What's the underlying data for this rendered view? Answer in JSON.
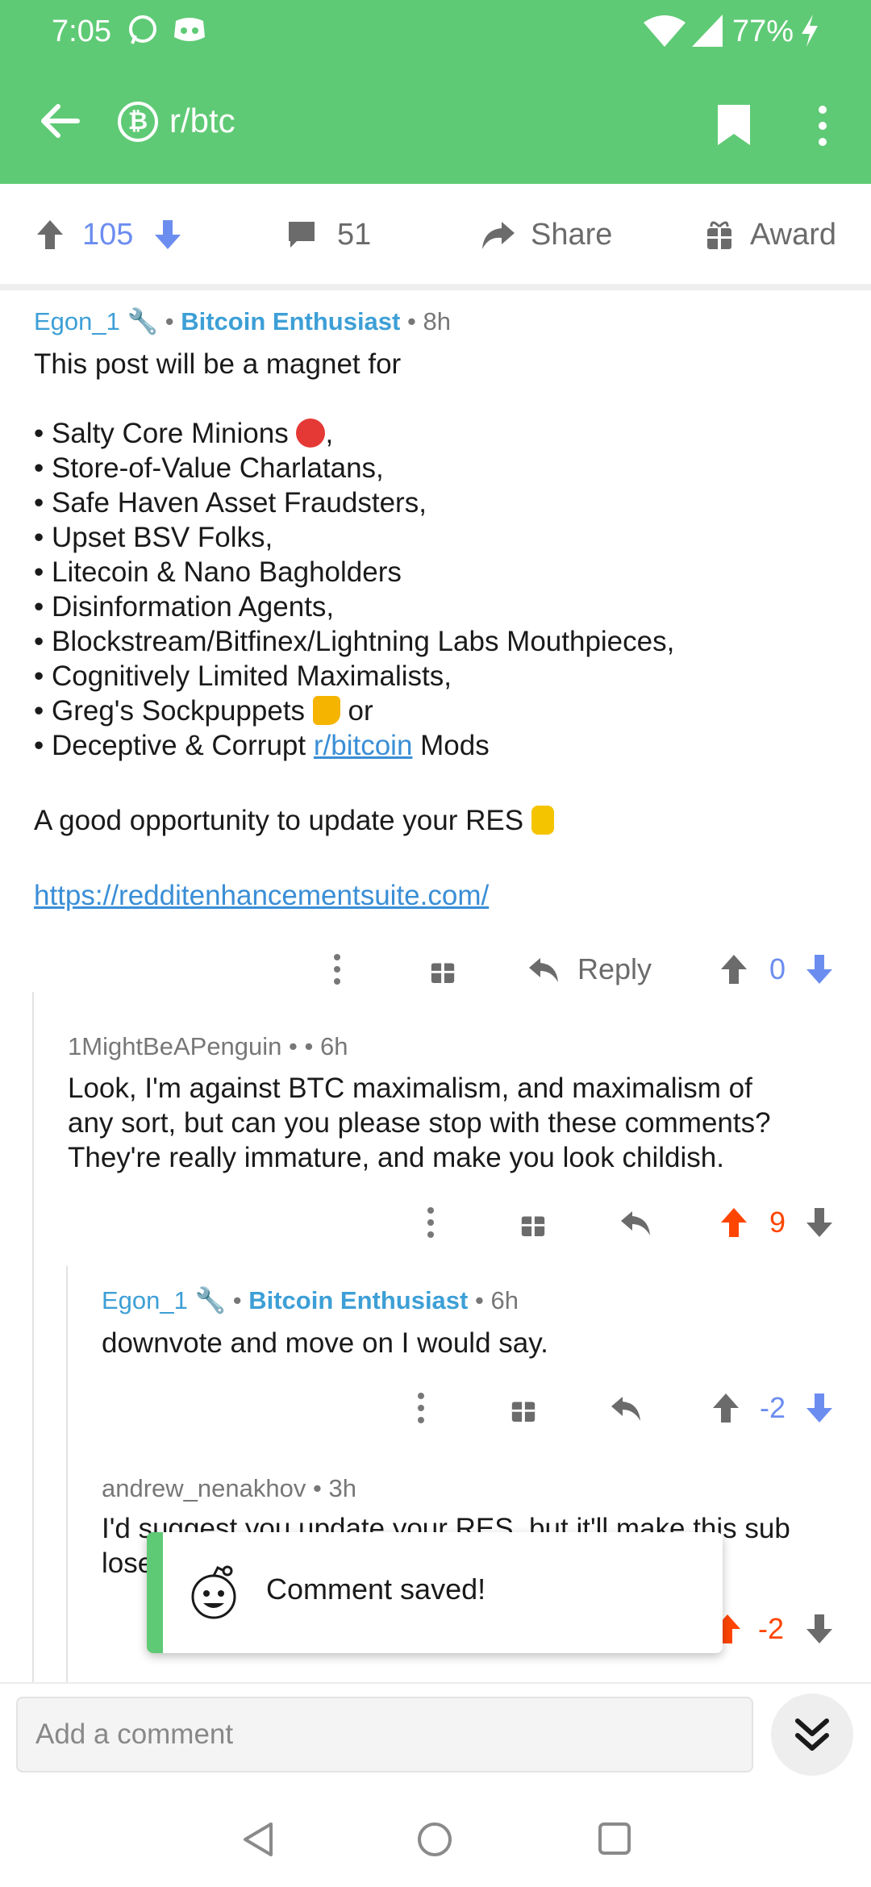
{
  "status": {
    "time": "7:05",
    "battery": "77%"
  },
  "appbar": {
    "subreddit": "r/btc",
    "logo_glyph": "₿"
  },
  "post_actions": {
    "score": "105",
    "comments": "51",
    "share": "Share",
    "award": "Award"
  },
  "comments": [
    {
      "user": "Egon_1",
      "flair": "Bitcoin Enthusiast",
      "time": "8h",
      "lines": [
        "This post will be a magnet for",
        "• Salty Core Minions",
        "• Store-of-Value Charlatans,",
        "• Safe Haven Asset Fraudsters,",
        "• Upset BSV Folks,",
        "• Litecoin & Nano Bagholders",
        "• Disinformation Agents,",
        "• Blockstream/Bitfinex/Lightning Labs Mouthpieces,",
        "• Cognitively Limited Maximalists,",
        "• Greg's Sockpuppets",
        "• Deceptive & Corrupt",
        "A good opportunity to update your RES"
      ],
      "line_suffixes": {
        "salty": ",",
        "greg": "or",
        "mods": "Mods"
      },
      "sub_link": "r/bitcoin",
      "url": "https://redditenhancementsuite.com/",
      "reply_label": "Reply",
      "score": "0"
    },
    {
      "user": "1MightBeAPenguin",
      "time": "6h",
      "lines": [
        "Look, I'm against BTC maximalism, and maximalism of",
        "any sort, but can you please stop with these comments?",
        "They're really immature, and make you look childish."
      ],
      "score": "9"
    },
    {
      "user": "Egon_1",
      "flair": "Bitcoin Enthusiast",
      "time": "6h",
      "lines": [
        "downvote and move on I would say."
      ],
      "score": "-2"
    },
    {
      "user": "andrew_nenakhov",
      "time": "3h",
      "lines": [
        "I'd suggest you update your RES, but it'll make this sub",
        "lose"
      ],
      "score": "-2"
    }
  ],
  "toast": {
    "message": "Comment saved!"
  },
  "composer": {
    "placeholder": "Add a comment"
  },
  "colors": {
    "brand": "#5fca75",
    "upvote": "#ff4500",
    "downvote": "#6c8df0",
    "link": "#3a8ed6"
  }
}
